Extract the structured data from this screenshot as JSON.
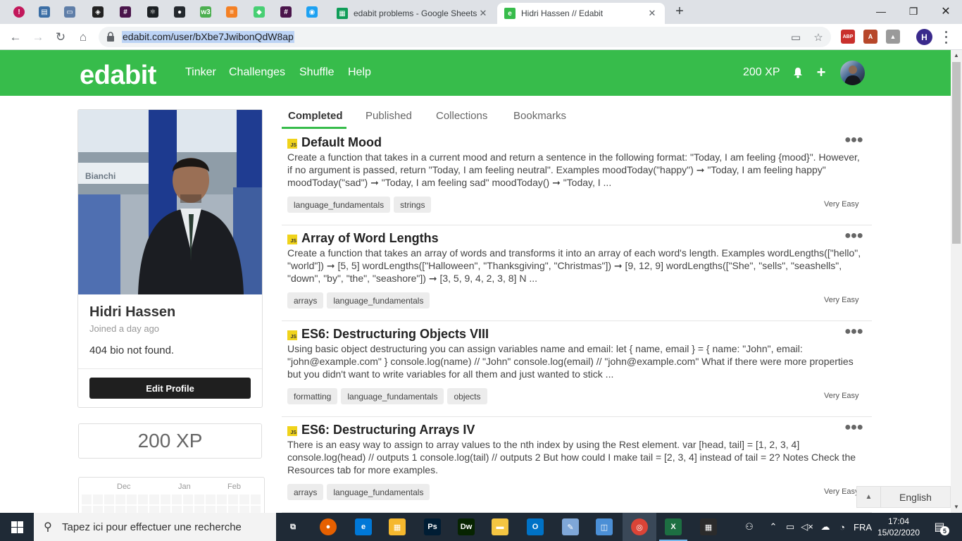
{
  "browser": {
    "pinned_tabs": [
      {
        "icon": "alert-circle-icon",
        "color": "#c2185b",
        "glyph": "!"
      },
      {
        "icon": "app-icon",
        "color": "#3b6ea5",
        "glyph": "▤"
      },
      {
        "icon": "window-icon",
        "color": "#5f7ea8",
        "glyph": "▭"
      },
      {
        "icon": "codesandbox-icon",
        "color": "#222222",
        "glyph": "◈"
      },
      {
        "icon": "slack-icon",
        "color": "#4a154b",
        "glyph": "#"
      },
      {
        "icon": "react-icon",
        "color": "#1b1f23",
        "glyph": "⚛"
      },
      {
        "icon": "github-icon",
        "color": "#24292e",
        "glyph": "●"
      },
      {
        "icon": "w3schools-icon",
        "color": "#4caf50",
        "glyph": "w3"
      },
      {
        "icon": "stackoverflow-icon",
        "color": "#f48024",
        "glyph": "≡"
      },
      {
        "icon": "codepen-icon",
        "color": "#47cf73",
        "glyph": "◆"
      },
      {
        "icon": "slack-icon",
        "color": "#4a154b",
        "glyph": "#"
      },
      {
        "icon": "chat-icon",
        "color": "#1da1f2",
        "glyph": "◉"
      }
    ],
    "tabs": [
      {
        "title": "edabit problems - Google Sheets",
        "icon": "google-sheets-icon",
        "color": "#0f9d58",
        "active": false
      },
      {
        "title": "Hidri Hassen // Edabit",
        "icon": "edabit-icon",
        "color": "#37bc4b",
        "active": true
      }
    ],
    "url": "edabit.com/user/bXbe7JwibonQdW8ap",
    "profile_initial": "H",
    "extensions": [
      {
        "icon": "adblock-icon",
        "color": "#c9302c",
        "glyph": "ABP",
        "badge": "2"
      },
      {
        "icon": "pdf-icon",
        "color": "#b7472a",
        "glyph": "A"
      },
      {
        "icon": "drive-icon",
        "color": "#999999",
        "glyph": "▲"
      }
    ]
  },
  "site": {
    "logo": "edabit",
    "nav": [
      "Tinker",
      "Challenges",
      "Shuffle",
      "Help"
    ],
    "xp_label": "200 XP",
    "brand_color": "#37bc4b"
  },
  "profile": {
    "name": "Hidri Hassen",
    "joined": "Joined a day ago",
    "bio": "404 bio not found.",
    "edit_label": "Edit Profile",
    "xp": "200 XP",
    "calendar_months": [
      "Dec",
      "Jan",
      "Feb"
    ],
    "photo_text": "Bianchi"
  },
  "tabs": [
    "Completed",
    "Published",
    "Collections",
    "Bookmarks"
  ],
  "challenges": [
    {
      "lang": "JS",
      "title": "Default Mood",
      "desc": "Create a function that takes in a current mood and return a sentence in the following format: \"Today, I am feeling {mood}\". However, if no argument is passed, return \"Today, I am feeling neutral\". Examples moodToday(\"happy\") ➞ \"Today, I am feeling happy\" moodToday(\"sad\") ➞ \"Today, I am feeling sad\" moodToday() ➞ \"Today, I ...",
      "tags": [
        "language_fundamentals",
        "strings"
      ],
      "difficulty": "Very Easy"
    },
    {
      "lang": "JS",
      "title": "Array of Word Lengths",
      "desc": "Create a function that takes an array of words and transforms it into an array of each word's length. Examples wordLengths([\"hello\", \"world\"]) ➞ [5, 5] wordLengths([\"Halloween\", \"Thanksgiving\", \"Christmas\"]) ➞ [9, 12, 9] wordLengths([\"She\", \"sells\", \"seashells\", \"down\", \"by\", \"the\", \"seashore\"]) ➞ [3, 5, 9, 4, 2, 3, 8] N ...",
      "tags": [
        "arrays",
        "language_fundamentals"
      ],
      "difficulty": "Very Easy"
    },
    {
      "lang": "JS",
      "title": "ES6: Destructuring Objects VIII",
      "desc": "Using basic object destructuring you can assign variables name and email: let { name, email } = { name: \"John\", email: \"john@example.com\" } console.log(name) // \"John\" console.log(email) // \"john@example.com\" What if there were more properties but you didn't want to write variables for all them and just wanted to stick ...",
      "tags": [
        "formatting",
        "language_fundamentals",
        "objects"
      ],
      "difficulty": "Very Easy"
    },
    {
      "lang": "JS",
      "title": "ES6: Destructuring Arrays IV",
      "desc": "There is an easy way to assign to array values to the nth index by using the Rest element. var [head, tail] = [1, 2, 3, 4] console.log(head) // outputs 1 console.log(tail) // outputs 2 But how could I make tail = [2, 3, 4] instead of tail = 2? Notes Check the Resources tab for more examples.",
      "tags": [
        "arrays",
        "language_fundamentals"
      ],
      "difficulty": "Very Easy"
    }
  ],
  "language_button": "English",
  "taskbar": {
    "search_placeholder": "Tapez ici pour effectuer une recherche",
    "apps": [
      {
        "icon": "task-view-icon",
        "color": "transparent",
        "glyph": "⧉",
        "state": ""
      },
      {
        "icon": "firefox-icon",
        "color": "#e66000",
        "glyph": "●",
        "state": ""
      },
      {
        "icon": "edge-icon",
        "color": "#0078d7",
        "glyph": "e",
        "state": ""
      },
      {
        "icon": "store-icon",
        "color": "#f5b82e",
        "glyph": "▦",
        "state": ""
      },
      {
        "icon": "photoshop-icon",
        "color": "#001d34",
        "glyph": "Ps",
        "state": ""
      },
      {
        "icon": "dreamweaver-icon",
        "color": "#072401",
        "glyph": "Dw",
        "state": ""
      },
      {
        "icon": "file-explorer-icon",
        "color": "#f4c542",
        "glyph": "▬",
        "state": ""
      },
      {
        "icon": "outlook-icon",
        "color": "#0072c6",
        "glyph": "O",
        "state": ""
      },
      {
        "icon": "paint-icon",
        "color": "#7fa7d8",
        "glyph": "✎",
        "state": ""
      },
      {
        "icon": "app-icon",
        "color": "#4b8fd6",
        "glyph": "◫",
        "state": ""
      },
      {
        "icon": "chrome-icon",
        "color": "#db4437",
        "glyph": "◎",
        "state": "active"
      },
      {
        "icon": "excel-icon",
        "color": "#1d6f42",
        "glyph": "X",
        "state": "running"
      },
      {
        "icon": "calculator-icon",
        "color": "#2b2b2b",
        "glyph": "▦",
        "state": ""
      }
    ],
    "tray_lang": "FRA",
    "time": "17:04",
    "date": "15/02/2020",
    "notifications": "5"
  }
}
